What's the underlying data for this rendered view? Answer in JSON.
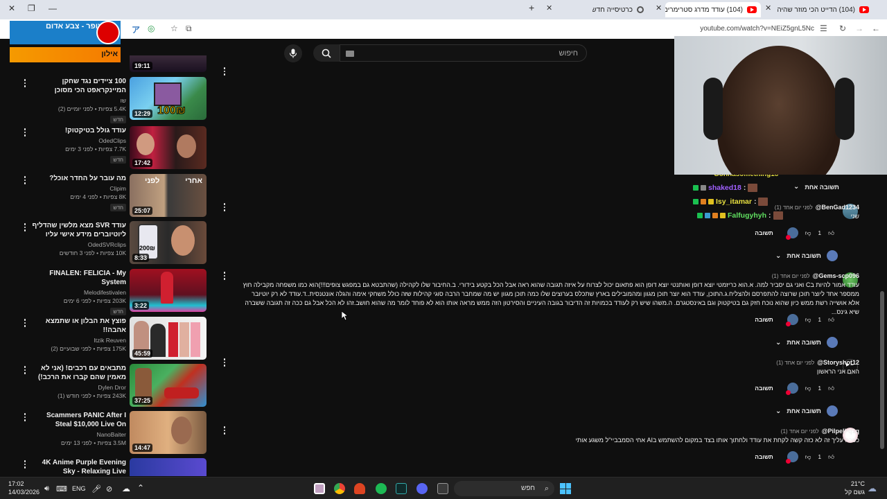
{
  "browser": {
    "tabs": [
      {
        "label": "(104) הדייט הכי מוזר שהיה לו..."
      },
      {
        "label": "(104) עודד מדרג סטרימרים!! (ה..."
      },
      {
        "label": "כרטיסייה חדשה"
      }
    ],
    "url": "youtube.com/watch?v=NEiZ5gnL5Nc",
    "new_tab": "+",
    "close": "✕"
  },
  "extension": {
    "top_text": "צופר - צבע אדום",
    "bottom_text": "אילון"
  },
  "search": {
    "placeholder": "חיפוש"
  },
  "related": [
    {
      "title": "",
      "channel": "",
      "meta": "",
      "duration": "19:11",
      "tag": ""
    },
    {
      "title": "100 ציידים נגד שחקן המיינקראפט הכי מסוכן בישראל!",
      "channel": "שו",
      "meta": "5.4K צפיות • לפני יומיים (2)",
      "duration": "12:29",
      "tag": "חדש",
      "thumb_text": "100₪"
    },
    {
      "title": "עודד גולל בטיקטוק!",
      "channel": "OdedClips",
      "meta": "7.7K צפיות • לפני 3 ימים",
      "duration": "17:42",
      "tag": "חדש"
    },
    {
      "title": "מה עובר על החדר אוכל?",
      "channel": "Clipim",
      "meta": "8K צפיות • לפני 4 ימים",
      "duration": "25:07",
      "tag": "חדש",
      "thumb_text_a": "אחרי",
      "thumb_text_b": "לפני"
    },
    {
      "title": "עודד SVR מצא מלשין שהדליף ליוטיוברים מידע אישי עליו (האם זה ...",
      "channel": "OdedSVRclips",
      "meta": "10K צפיות • לפני 3 חודשים",
      "duration": "8:33",
      "tag": "",
      "thumb_text": "200₪"
    },
    {
      "title": "FINALEN: FELICIA - My System",
      "channel": "Melodifestivalen",
      "meta": "203K צפיות • לפני 6 ימים",
      "duration": "3:22",
      "tag": "חדש"
    },
    {
      "title": "פוצץ את הבלון או שתמצא אהבה!!",
      "channel": "Itzik Reuven",
      "meta": "175K צפיות • לפני שבועיים (2)",
      "duration": "45:59",
      "tag": ""
    },
    {
      "title": "מתבאים עם רכבים! (אני לא מאמין שהם קברו את הרכב!)",
      "channel": "Dylen Dror",
      "meta": "243K צפיות • לפני חודש (1)",
      "duration": "37:25",
      "tag": ""
    },
    {
      "title": "Scammers PANIC After I Steal $10,000 Live On Webcam!",
      "channel": "NanoBaiter",
      "meta": "3.5M צפיות • לפני 13 ימים",
      "duration": "14:47",
      "tag": ""
    },
    {
      "title": "4K Anime Purple Evening Sky - Relaxing Live Wallpaper - 1 ...",
      "channel": "",
      "meta": "",
      "duration": "",
      "tag": ""
    }
  ],
  "chat": [
    {
      "user": "Gonnasomething18",
      "text": ""
    },
    {
      "user": "shaked18",
      "sep": ":"
    },
    {
      "user": "Isy_itamar",
      "sep": ":"
    },
    {
      "user": "Falfugyhyh",
      "sep": ":"
    }
  ],
  "comments": [
    {
      "author": "BenGad1234@",
      "time": "לפני יום אחד (1)",
      "text": "שני",
      "likes": "1",
      "reply_label": "תשובה",
      "replies_label": "תשובה אחת"
    },
    {
      "author": "Gems-scp096@",
      "time": "לפני יום אחד (1)",
      "text": "עודד אמור להיות בC ואני גם יסביר למה. א.הוא כריזמטי יוצא דופן ואותנטי  יוצא דופן הוא פתאום יכול לצרוח על איזה תגובה שהוא ראה אבל הכל בקטע בידורי. ב.החיבור שלו לקהילה (שהתבטא גם במפגש צופים!!!)הוא כמו משפחה מקבילה חוץ ממספר אחד ליוצר תוכן שרוצה להתפרסם ולהצליח.ג.התוכן, עודד הוא יוצר תוכן מגוון ומהמובילים בארץ שתכלס בערוצים שלו כמה תוכן מגוון יש מה שמחבר הרבה סוגי קהילות שזה כולל משחקי אימה והגלה אונטנסית..ד.עודד לא רק יוטיובר אלא אושייה רשת ממש כיון שהוא נוכח חזק גם בטיקטוק וגם באינסטגרם. ה.משהו שיש רק לעודד בכמויות זה הדיבור בגובה העיניים והסירטון הזה ממש מראה אותו הוא לא פוחד לומר מה שהוא חושב.זהו לא הכל אבל גם ככה זה תגובה ששברה שיא גינס...",
      "likes": "1",
      "reply_label": "תשובה",
      "replies_label": "תשובה אחת"
    },
    {
      "author": "Storyshot12@",
      "time": "לפני יום אחד (1)",
      "text": "האם אני הראשון",
      "likes": "1",
      "reply_label": "תשובה",
      "replies_label": "תשובה אחת"
    },
    {
      "author": "Pilpeli-q1q@",
      "time": "לפני יום אחד (1)",
      "text": "כפרה עליך זה לא כזה קשה לקחת את עודד ולחתוך אותו בצד במקום להשתמש בAI אחי הסמבביי\"ל משגע אותי",
      "likes": "1",
      "reply_label": "תשובה",
      "replies_label": ""
    }
  ],
  "top_replies_label": "תשובה אחת",
  "taskbar": {
    "time": "17:02",
    "date": "14/03/2026",
    "lang": "ENG",
    "search": "חפש",
    "weather_temp": "21°C",
    "weather_desc": "גשם קל"
  }
}
